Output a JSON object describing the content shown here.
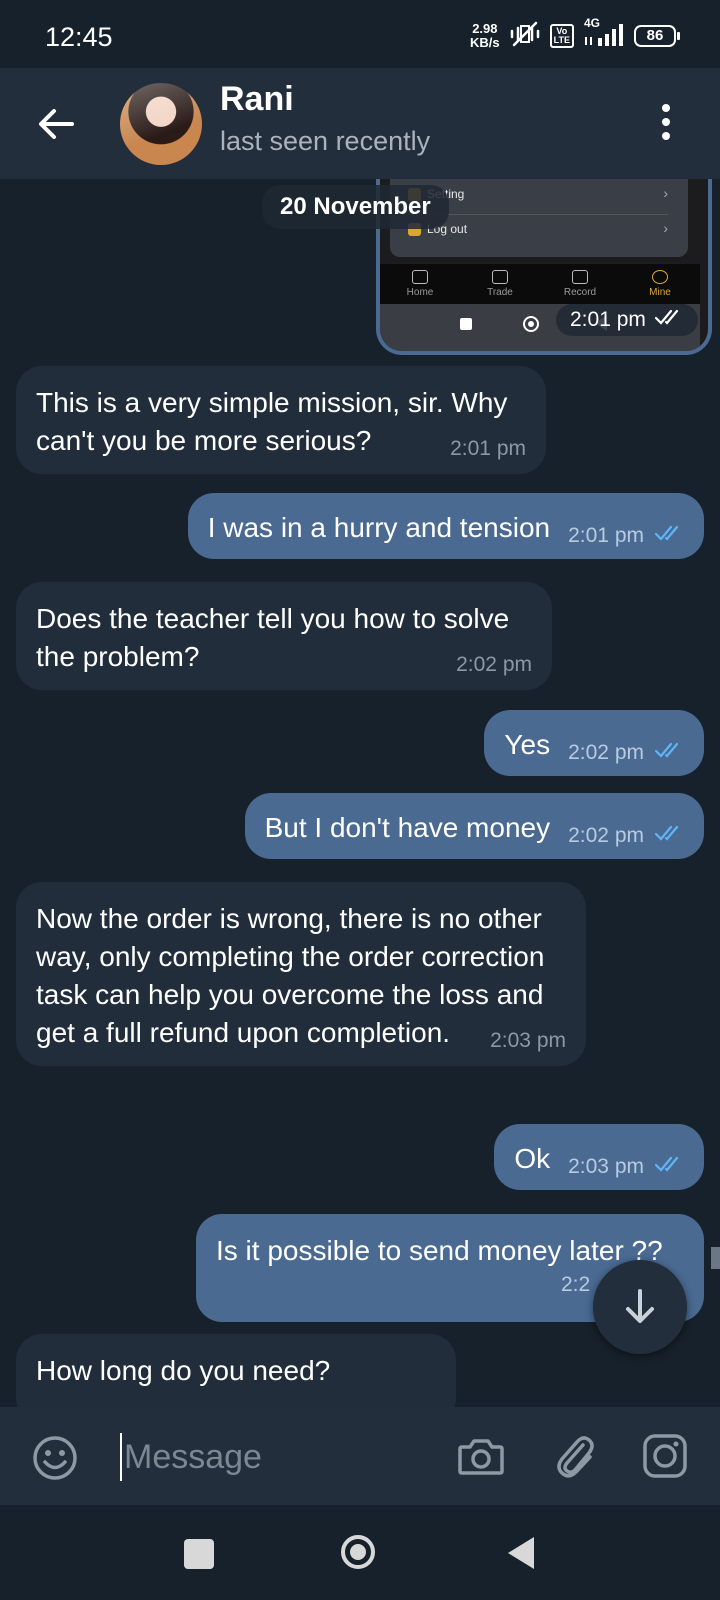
{
  "status_bar": {
    "time": "12:45",
    "net_speed_value": "2.98",
    "net_speed_unit": "KB/s",
    "volte_top": "Vo",
    "volte_bottom": "LTE",
    "network": "4G",
    "battery": "86"
  },
  "header": {
    "contact_name": "Rani",
    "status": "last seen recently"
  },
  "shared_screenshot": {
    "menu_rows": [
      "Setting",
      "Log out"
    ],
    "tabs": [
      "Home",
      "Trade",
      "Record",
      "Mine"
    ],
    "active_tab": "Mine",
    "time": "2:01 pm"
  },
  "date_separator": "20 November",
  "messages": [
    {
      "direction": "in",
      "text": "This is a very simple mission, sir. Why can't you be more serious?",
      "time": "2:01 pm"
    },
    {
      "direction": "out",
      "text": "I was in a hurry and tension",
      "time": "2:01 pm"
    },
    {
      "direction": "in",
      "text": "Does the teacher tell you how to solve the problem?",
      "time": "2:02 pm"
    },
    {
      "direction": "out",
      "text": "Yes",
      "time": "2:02 pm"
    },
    {
      "direction": "out",
      "text": "But I don't have money",
      "time": "2:02 pm"
    },
    {
      "direction": "in",
      "text": "Now the order is wrong, there is no other way, only completing the order correction task can help you overcome the loss and get a full refund upon completion.",
      "time": "2:03 pm"
    },
    {
      "direction": "out",
      "text": "Ok",
      "time": "2:03 pm"
    },
    {
      "direction": "out",
      "text": "Is it possible to send money later ??",
      "time": "2:2"
    },
    {
      "direction": "in",
      "text": "How long do you need?",
      "time": ""
    }
  ],
  "composer": {
    "placeholder": "Message"
  },
  "colors": {
    "background": "#17212b",
    "header": "#232e3c",
    "incoming_bubble": "#212d3b",
    "outgoing_bubble": "#4a6a92",
    "read_tick": "#5eb5f7"
  },
  "icons": [
    "back-arrow-icon",
    "more-vert-icon",
    "double-check-icon",
    "scroll-down-icon",
    "emoji-icon",
    "camera-icon",
    "attach-icon",
    "instagram-icon"
  ]
}
